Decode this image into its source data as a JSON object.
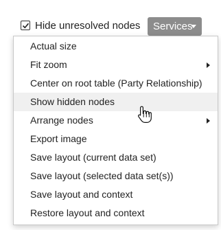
{
  "toolbar": {
    "hide_unresolved": {
      "label": "Hide unresolved nodes",
      "checked": true
    },
    "services": {
      "label": "Services",
      "icon": "caret-down-icon"
    }
  },
  "menu": {
    "items": [
      {
        "label": "Actual size",
        "has_submenu": false
      },
      {
        "label": "Fit zoom",
        "has_submenu": true
      },
      {
        "label": "Center on root table (Party Relationship)",
        "has_submenu": false
      },
      {
        "label": "Show hidden nodes",
        "has_submenu": false,
        "highlighted": true
      },
      {
        "label": "Arrange nodes",
        "has_submenu": true
      },
      {
        "label": "Export image",
        "has_submenu": false
      },
      {
        "label": "Save layout (current data set)",
        "has_submenu": false
      },
      {
        "label": "Save layout (selected data set(s))",
        "has_submenu": false
      },
      {
        "label": "Save layout and context",
        "has_submenu": false
      },
      {
        "label": "Restore layout and context",
        "has_submenu": false
      }
    ]
  },
  "cursor": {
    "icon": "hand-pointer-icon"
  }
}
